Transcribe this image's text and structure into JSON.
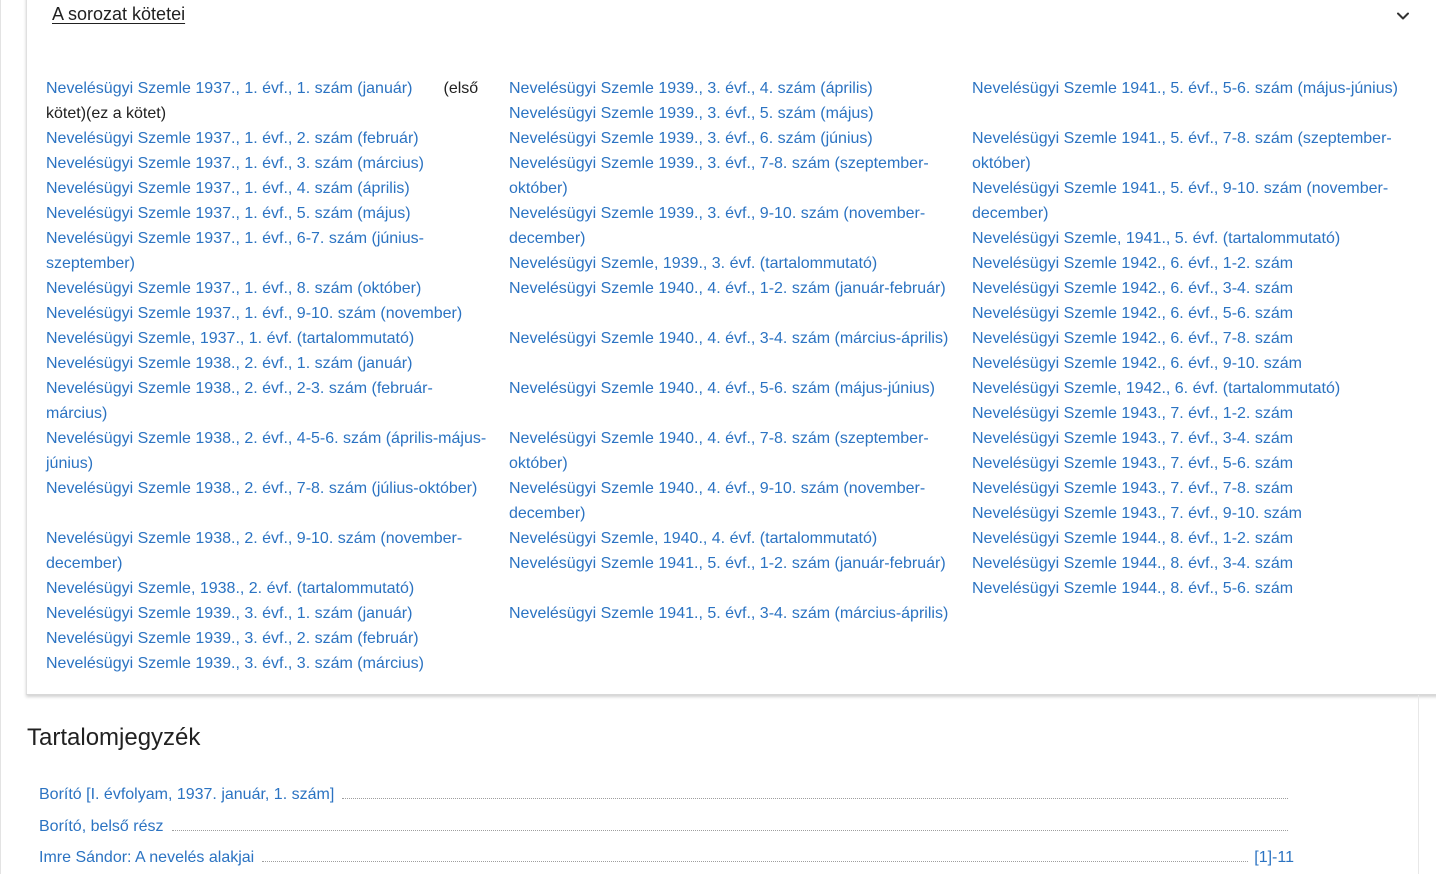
{
  "panel": {
    "title": "A sorozat kötetei",
    "chevron_icon": "chevron-down-icon",
    "col1": [
      {
        "label": "Nevelésügyi Szemle 1937., 1. évf., 1. szám (január)",
        "note": "(első kötet)(ez a kötet)"
      },
      {
        "label": "Nevelésügyi Szemle 1937., 1. évf., 2. szám (február)"
      },
      {
        "label": "Nevelésügyi Szemle 1937., 1. évf., 3. szám (március)"
      },
      {
        "label": "Nevelésügyi Szemle 1937., 1. évf., 4. szám (április)"
      },
      {
        "label": "Nevelésügyi Szemle 1937., 1. évf., 5. szám (május)"
      },
      {
        "label": "Nevelésügyi Szemle 1937., 1. évf., 6-7. szám (június-szeptember)"
      },
      {
        "label": "Nevelésügyi Szemle 1937., 1. évf., 8. szám (október)"
      },
      {
        "label": "Nevelésügyi Szemle 1937., 1. évf., 9-10. szám (november)"
      },
      {
        "label": "Nevelésügyi Szemle, 1937., 1. évf. (tartalommutató)"
      },
      {
        "label": "Nevelésügyi Szemle 1938., 2. évf., 1. szám (január)"
      },
      {
        "label": "Nevelésügyi Szemle 1938., 2. évf., 2-3. szám (február-március)"
      },
      {
        "label": "Nevelésügyi Szemle 1938., 2. évf., 4-5-6. szám (április-május-június)"
      },
      {
        "label": "Nevelésügyi Szemle 1938., 2. évf., 7-8. szám (július-október)"
      },
      {
        "label": "Nevelésügyi Szemle 1938., 2. évf., 9-10. szám (november-december)"
      },
      {
        "label": "Nevelésügyi Szemle, 1938., 2. évf. (tartalommutató)"
      },
      {
        "label": "Nevelésügyi Szemle 1939., 3. évf., 1. szám (január)"
      },
      {
        "label": "Nevelésügyi Szemle 1939., 3. évf., 2. szám (február)"
      },
      {
        "label": "Nevelésügyi Szemle 1939., 3. évf., 3. szám (március)"
      }
    ],
    "col2": [
      {
        "label": "Nevelésügyi Szemle 1939., 3. évf., 4. szám (április)"
      },
      {
        "label": "Nevelésügyi Szemle 1939., 3. évf., 5. szám (május)"
      },
      {
        "label": "Nevelésügyi Szemle 1939., 3. évf., 6. szám (június)"
      },
      {
        "label": "Nevelésügyi Szemle 1939., 3. évf., 7-8. szám (szeptember-október)"
      },
      {
        "label": "Nevelésügyi Szemle 1939., 3. évf., 9-10. szám (november-december)"
      },
      {
        "label": "Nevelésügyi Szemle, 1939., 3. évf. (tartalommutató)"
      },
      {
        "label": "Nevelésügyi Szemle 1940., 4. évf., 1-2. szám (január-február)"
      },
      {
        "label": "Nevelésügyi Szemle 1940., 4. évf., 3-4. szám (március-április)"
      },
      {
        "label": "Nevelésügyi Szemle 1940., 4. évf., 5-6. szám (május-június)"
      },
      {
        "label": "Nevelésügyi Szemle 1940., 4. évf., 7-8. szám (szeptember-október)"
      },
      {
        "label": "Nevelésügyi Szemle 1940., 4. évf., 9-10. szám (november-december)"
      },
      {
        "label": "Nevelésügyi Szemle, 1940., 4. évf. (tartalommutató)"
      },
      {
        "label": "Nevelésügyi Szemle 1941., 5. évf., 1-2. szám (január-február)"
      },
      {
        "label": "Nevelésügyi Szemle 1941., 5. évf., 3-4. szám (március-április)"
      }
    ],
    "col3": [
      {
        "label": "Nevelésügyi Szemle 1941., 5. évf., 5-6. szám (május-június)"
      },
      {
        "label": "Nevelésügyi Szemle 1941., 5. évf., 7-8. szám (szeptember-október)"
      },
      {
        "label": "Nevelésügyi Szemle 1941., 5. évf., 9-10. szám (november-december)"
      },
      {
        "label": "Nevelésügyi Szemle, 1941., 5. évf. (tartalommutató)"
      },
      {
        "label": "Nevelésügyi Szemle 1942., 6. évf., 1-2. szám"
      },
      {
        "label": "Nevelésügyi Szemle 1942., 6. évf., 3-4. szám"
      },
      {
        "label": "Nevelésügyi Szemle 1942., 6. évf., 5-6. szám"
      },
      {
        "label": "Nevelésügyi Szemle 1942., 6. évf., 7-8. szám"
      },
      {
        "label": "Nevelésügyi Szemle 1942., 6. évf., 9-10. szám"
      },
      {
        "label": "Nevelésügyi Szemle, 1942., 6. évf. (tartalommutató)"
      },
      {
        "label": "Nevelésügyi Szemle 1943., 7. évf., 1-2. szám"
      },
      {
        "label": "Nevelésügyi Szemle 1943., 7. évf., 3-4. szám"
      },
      {
        "label": "Nevelésügyi Szemle 1943., 7. évf., 5-6. szám"
      },
      {
        "label": "Nevelésügyi Szemle 1943., 7. évf., 7-8. szám"
      },
      {
        "label": "Nevelésügyi Szemle 1943., 7. évf., 9-10. szám"
      },
      {
        "label": "Nevelésügyi Szemle 1944., 8. évf., 1-2. szám"
      },
      {
        "label": "Nevelésügyi Szemle 1944., 8. évf., 3-4. szám"
      },
      {
        "label": "Nevelésügyi Szemle 1944., 8. évf., 5-6. szám"
      }
    ]
  },
  "toc": {
    "title": "Tartalomjegyzék",
    "items": [
      {
        "title": "Borító [I. évfolyam, 1937. január, 1. szám]",
        "pages": ""
      },
      {
        "title": "Borító, belső rész",
        "pages": ""
      },
      {
        "title": "Imre Sándor: A nevelés alakjai",
        "pages": "[1]-11"
      }
    ]
  },
  "colors": {
    "link": "#2b73c2",
    "text": "#212121"
  }
}
